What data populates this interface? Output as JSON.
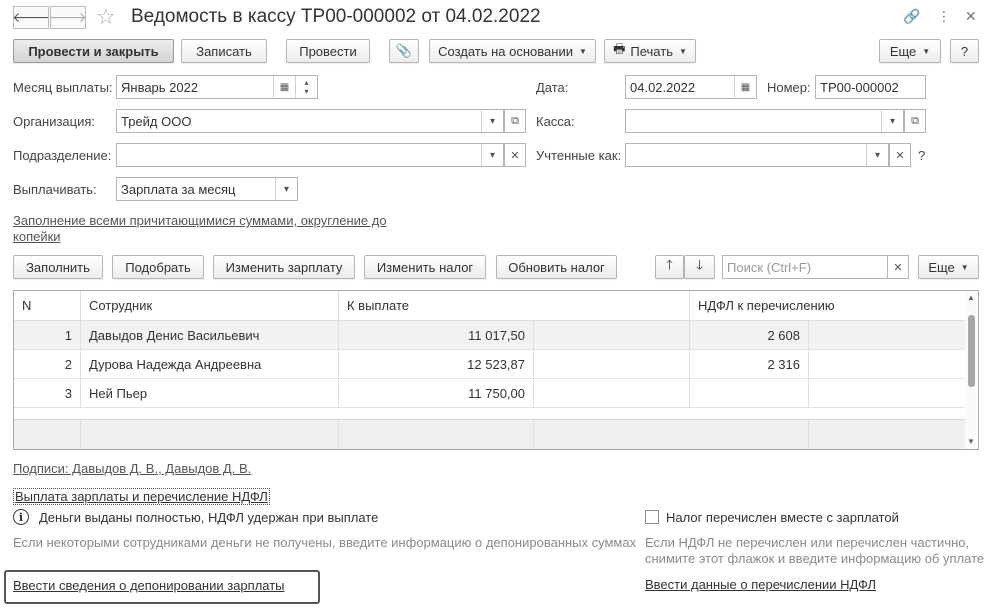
{
  "window": {
    "title": "Ведомость в кассу ТР00-000002 от 04.02.2022",
    "back_icon": "arrow-left-icon",
    "forward_icon": "arrow-right-icon",
    "star_icon": "star-icon"
  },
  "toolbar": {
    "post_close": "Провести и закрыть",
    "save": "Записать",
    "post": "Провести",
    "create_based_on": "Создать на основании",
    "print": "Печать",
    "more": "Еще",
    "help": "?"
  },
  "form": {
    "month_label": "Месяц выплаты:",
    "month_value": "Январь 2022",
    "date_label": "Дата:",
    "date_value": "04.02.2022",
    "number_label": "Номер:",
    "number_value": "ТР00-000002",
    "org_label": "Организация:",
    "org_value": "Трейд ООО",
    "cashbox_label": "Касса:",
    "cashbox_value": "",
    "division_label": "Подразделение:",
    "division_value": "",
    "accounted_label": "Учтенные как:",
    "accounted_value": "",
    "accounted_help": "?",
    "pay_label": "Выплачивать:",
    "pay_value": "Зарплата за месяц",
    "fill_link": "Заполнение всеми причитающимися суммами, округление до",
    "fill_link_2": "копейки"
  },
  "table_toolbar": {
    "fill": "Заполнить",
    "pick": "Подобрать",
    "change_salary": "Изменить зарплату",
    "change_tax": "Изменить налог",
    "update_tax": "Обновить налог",
    "search_placeholder": "Поиск (Ctrl+F)",
    "more": "Еще"
  },
  "table": {
    "columns": [
      "N",
      "Сотрудник",
      "К выплате",
      "НДФЛ к перечислению"
    ],
    "rows": [
      {
        "n": "1",
        "employee": "Давыдов Денис Васильевич",
        "amount": "11 017,50",
        "tax": "2 608"
      },
      {
        "n": "2",
        "employee": "Дурова Надежда Андреевна",
        "amount": "12 523,87",
        "tax": "2 316"
      },
      {
        "n": "3",
        "employee": "Ней Пьер",
        "amount": "11 750,00",
        "tax": ""
      }
    ]
  },
  "bottom": {
    "signatures_link": "Подписи: Давыдов Д. В., Давыдов Д. В.",
    "section_link": "Выплата зарплаты и перечисление НДФЛ",
    "info_text": "Деньги выданы полностью, НДФЛ удержан при выплате",
    "deposit_hint": "Если некоторыми сотрудниками деньги не получены, введите информацию о депонированных суммах",
    "deposit_link": "Ввести сведения о депонировании зарплаты",
    "tax_checkbox_label": "Налог перечислен вместе с зарплатой",
    "tax_hint_1": "Если НДФЛ не перечислен или перечислен частично,",
    "tax_hint_2": "снимите этот флажок и введите информацию об уплате",
    "tax_link": "Ввести данные о перечислении НДФЛ"
  }
}
